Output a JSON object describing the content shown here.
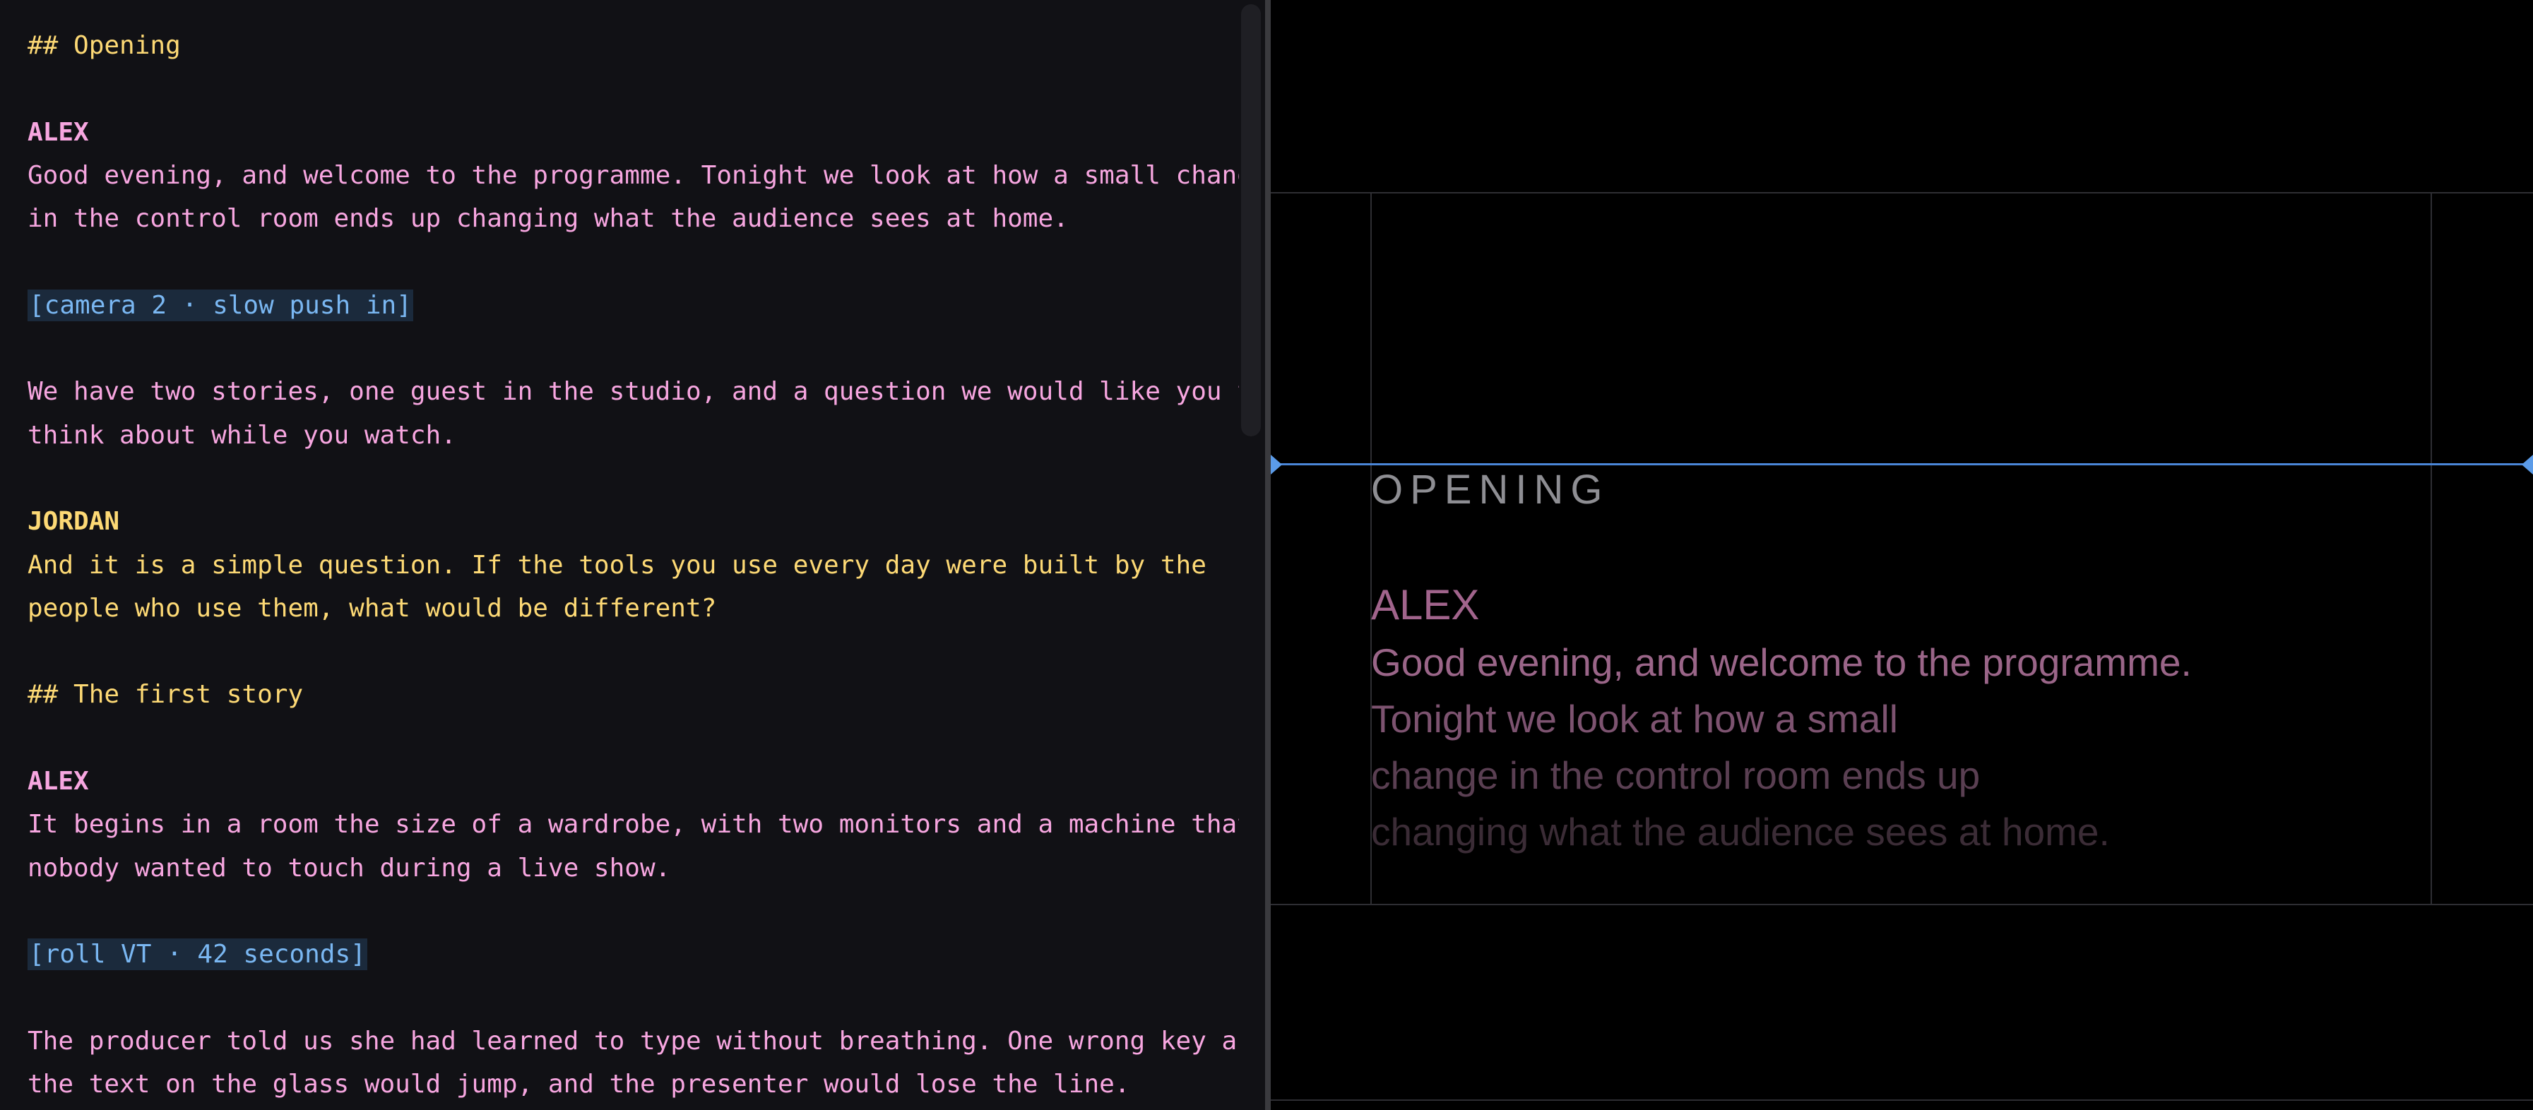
{
  "editor": {
    "lines": [
      {
        "kind": "heading",
        "text": "## Opening"
      },
      {
        "kind": "blank",
        "text": ""
      },
      {
        "kind": "speaker-alex",
        "text": "ALEX"
      },
      {
        "kind": "dialog-alex",
        "text": "Good evening, and welcome to the programme. Tonight we look at how a small change"
      },
      {
        "kind": "dialog-alex",
        "text": "in the control room ends up changing what the audience sees at home."
      },
      {
        "kind": "blank",
        "text": ""
      },
      {
        "kind": "cue",
        "text": "[camera 2 · slow push in]"
      },
      {
        "kind": "blank",
        "text": ""
      },
      {
        "kind": "dialog-alex",
        "text": "We have two stories, one guest in the studio, and a question we would like you to"
      },
      {
        "kind": "dialog-alex",
        "text": "think about while you watch."
      },
      {
        "kind": "blank",
        "text": ""
      },
      {
        "kind": "speaker-jordan",
        "text": "JORDAN"
      },
      {
        "kind": "dialog-jordan",
        "text": "And it is a simple question. If the tools you use every day were built by the"
      },
      {
        "kind": "dialog-jordan",
        "text": "people who use them, what would be different?"
      },
      {
        "kind": "blank",
        "text": ""
      },
      {
        "kind": "heading",
        "text": "## The first story"
      },
      {
        "kind": "blank",
        "text": ""
      },
      {
        "kind": "speaker-alex",
        "text": "ALEX"
      },
      {
        "kind": "dialog-alex",
        "text": "It begins in a room the size of a wardrobe, with two monitors and a machine that"
      },
      {
        "kind": "dialog-alex",
        "text": "nobody wanted to touch during a live show."
      },
      {
        "kind": "blank",
        "text": ""
      },
      {
        "kind": "cue",
        "text": "[roll VT · 42 seconds]"
      },
      {
        "kind": "blank",
        "text": ""
      },
      {
        "kind": "dialog-alex",
        "text": "The producer told us she had learned to type without breathing. One wrong key and"
      },
      {
        "kind": "dialog-alex",
        "text": "the text on the glass would jump, and the presenter would lose the line."
      }
    ]
  },
  "preview": {
    "heading": "OPENING",
    "speaker": "ALEX",
    "lines": [
      "Good evening, and welcome to the programme.",
      "Tonight we look at how a small",
      "change in the control room ends up",
      "changing what the audience sees at home."
    ]
  },
  "colors": {
    "editor_bg": "#111115",
    "heading": "#fdd975",
    "alex": "#f7a6e0",
    "jordan": "#fdd975",
    "cue_text": "#7ab7f2",
    "cue_bg": "#1b2a3c",
    "reading_line": "#4a86d8"
  }
}
